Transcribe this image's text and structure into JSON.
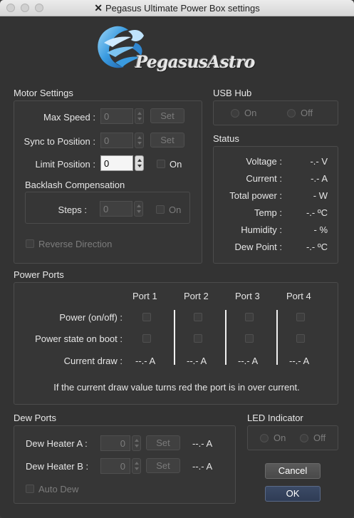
{
  "window": {
    "title": "Pegasus Ultimate Power Box settings",
    "title_icon": "x-logo-icon"
  },
  "logo": {
    "text": "PegasusAstro",
    "color": "#3fa3e0"
  },
  "motor": {
    "section_label": "Motor Settings",
    "max_speed_label": "Max Speed :",
    "max_speed_value": "0",
    "max_speed_set": "Set",
    "sync_label": "Sync to Position :",
    "sync_value": "0",
    "sync_set": "Set",
    "limit_label": "Limit Position :",
    "limit_value": "0",
    "limit_on_label": "On",
    "backlash_label": "Backlash Compensation",
    "steps_label": "Steps :",
    "steps_value": "0",
    "steps_on_label": "On",
    "reverse_label": "Reverse Direction"
  },
  "usb": {
    "section_label": "USB Hub",
    "on_label": "On",
    "off_label": "Off"
  },
  "status": {
    "section_label": "Status",
    "rows": [
      {
        "label": "Voltage :",
        "value": "-.- V"
      },
      {
        "label": "Current :",
        "value": "-.- A"
      },
      {
        "label": "Total power :",
        "value": "- W"
      },
      {
        "label": "Temp :",
        "value": "-.- ºC"
      },
      {
        "label": "Humidity :",
        "value": "- %"
      },
      {
        "label": "Dew Point :",
        "value": "-.- ºC"
      }
    ]
  },
  "power": {
    "section_label": "Power Ports",
    "ports": [
      "Port 1",
      "Port 2",
      "Port 3",
      "Port 4"
    ],
    "power_label": "Power (on/off) :",
    "boot_label": "Power state on boot :",
    "draw_label": "Current draw :",
    "draws": [
      "--.- A",
      "--.- A",
      "--.- A",
      "--.- A"
    ],
    "note": "If the current draw value turns red the port is in over current."
  },
  "dew": {
    "section_label": "Dew Ports",
    "heater_a_label": "Dew Heater A :",
    "heater_a_value": "0",
    "heater_a_set": "Set",
    "heater_a_current": "--.- A",
    "heater_b_label": "Dew Heater B :",
    "heater_b_value": "0",
    "heater_b_set": "Set",
    "heater_b_current": "--.- A",
    "auto_label": "Auto Dew"
  },
  "led": {
    "section_label": "LED Indicator",
    "on_label": "On",
    "off_label": "Off"
  },
  "buttons": {
    "cancel": "Cancel",
    "ok": "OK"
  }
}
